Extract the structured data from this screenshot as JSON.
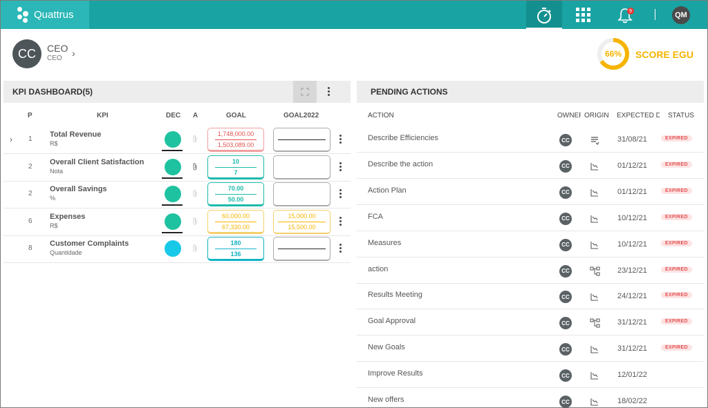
{
  "app": {
    "brand": "Quattrus",
    "user_initials": "QM",
    "notification_count": "9"
  },
  "profile": {
    "initials": "CC",
    "name": "CEO",
    "role": "CEO"
  },
  "score": {
    "percent": "66%",
    "label": "SCORE EGU",
    "value": 0.66,
    "color": "#f5b400"
  },
  "kpi": {
    "title": "KPI DASHBOARD(5)",
    "headers": {
      "p": "P",
      "kpi": "KPI",
      "dec": "DEC",
      "a": "A",
      "goal": "GOAL",
      "goal2022": "GOAL2022"
    },
    "rows": [
      {
        "p": "1",
        "name": "Total Revenue",
        "unit": "R$",
        "dec_color": "#1fc2a0",
        "goal_top": "1,748,000.00",
        "goal_bottom": "1,503,089.00",
        "goal_color": "red",
        "g22_top": "",
        "g22_bottom": "",
        "g22_color": "dark"
      },
      {
        "p": "2",
        "name": "Overall Client Satisfaction",
        "unit": "Nota",
        "dec_color": "#1fc2a0",
        "goal_top": "10",
        "goal_bottom": "7",
        "goal_color": "teal",
        "g22_top": "",
        "g22_bottom": "",
        "g22_color": "none"
      },
      {
        "p": "2",
        "name": "Overall Savings",
        "unit": "%",
        "dec_color": "#1fc2a0",
        "goal_top": "70.00",
        "goal_bottom": "50.00",
        "goal_color": "teal",
        "g22_top": "",
        "g22_bottom": "",
        "g22_color": "none"
      },
      {
        "p": "6",
        "name": "Expenses",
        "unit": "R$",
        "dec_color": "#1fc2a0",
        "goal_top": "60,000.00",
        "goal_bottom": "67,330.00",
        "goal_color": "amber",
        "g22_top": "15,000.00",
        "g22_bottom": "15,500.00",
        "g22_color": "amber"
      },
      {
        "p": "8",
        "name": "Customer Complaints",
        "unit": "Quantidade",
        "dec_color": "#18c8e8",
        "goal_top": "180",
        "goal_bottom": "136",
        "goal_color": "cyan",
        "g22_top": "",
        "g22_bottom": "",
        "g22_color": "dark"
      }
    ]
  },
  "pending": {
    "title": "PENDING ACTIONS",
    "headers": {
      "action": "ACTION",
      "owner": "OWNEF",
      "origin": "ORIGIN",
      "expected": "EXPECTED DA",
      "status": "STATUS"
    },
    "rows": [
      {
        "action": "Describe Efficiencies",
        "owner": "CC",
        "origin": "list",
        "date": "31/08/21",
        "status": "EXPIRED"
      },
      {
        "action": "Describe the action",
        "owner": "CC",
        "origin": "chart",
        "date": "01/12/21",
        "status": "EXPIRED"
      },
      {
        "action": "Action Plan",
        "owner": "CC",
        "origin": "chart",
        "date": "01/12/21",
        "status": "EXPIRED"
      },
      {
        "action": "FCA",
        "owner": "CC",
        "origin": "chart",
        "date": "10/12/21",
        "status": "EXPIRED"
      },
      {
        "action": "Measures",
        "owner": "CC",
        "origin": "chart",
        "date": "10/12/21",
        "status": "EXPIRED"
      },
      {
        "action": "action",
        "owner": "CC",
        "origin": "tree",
        "date": "23/12/21",
        "status": "EXPIRED"
      },
      {
        "action": "Results Meeting",
        "owner": "CC",
        "origin": "chart",
        "date": "24/12/21",
        "status": "EXPIRED"
      },
      {
        "action": "Goal Approval",
        "owner": "CC",
        "origin": "tree",
        "date": "31/12/21",
        "status": "EXPIRED"
      },
      {
        "action": "New Goals",
        "owner": "CC",
        "origin": "chart",
        "date": "31/12/21",
        "status": "EXPIRED"
      },
      {
        "action": "Improve Results",
        "owner": "CC",
        "origin": "chart",
        "date": "12/01/22",
        "status": ""
      },
      {
        "action": "New offers",
        "owner": "CC",
        "origin": "chart",
        "date": "18/02/22",
        "status": ""
      }
    ]
  }
}
